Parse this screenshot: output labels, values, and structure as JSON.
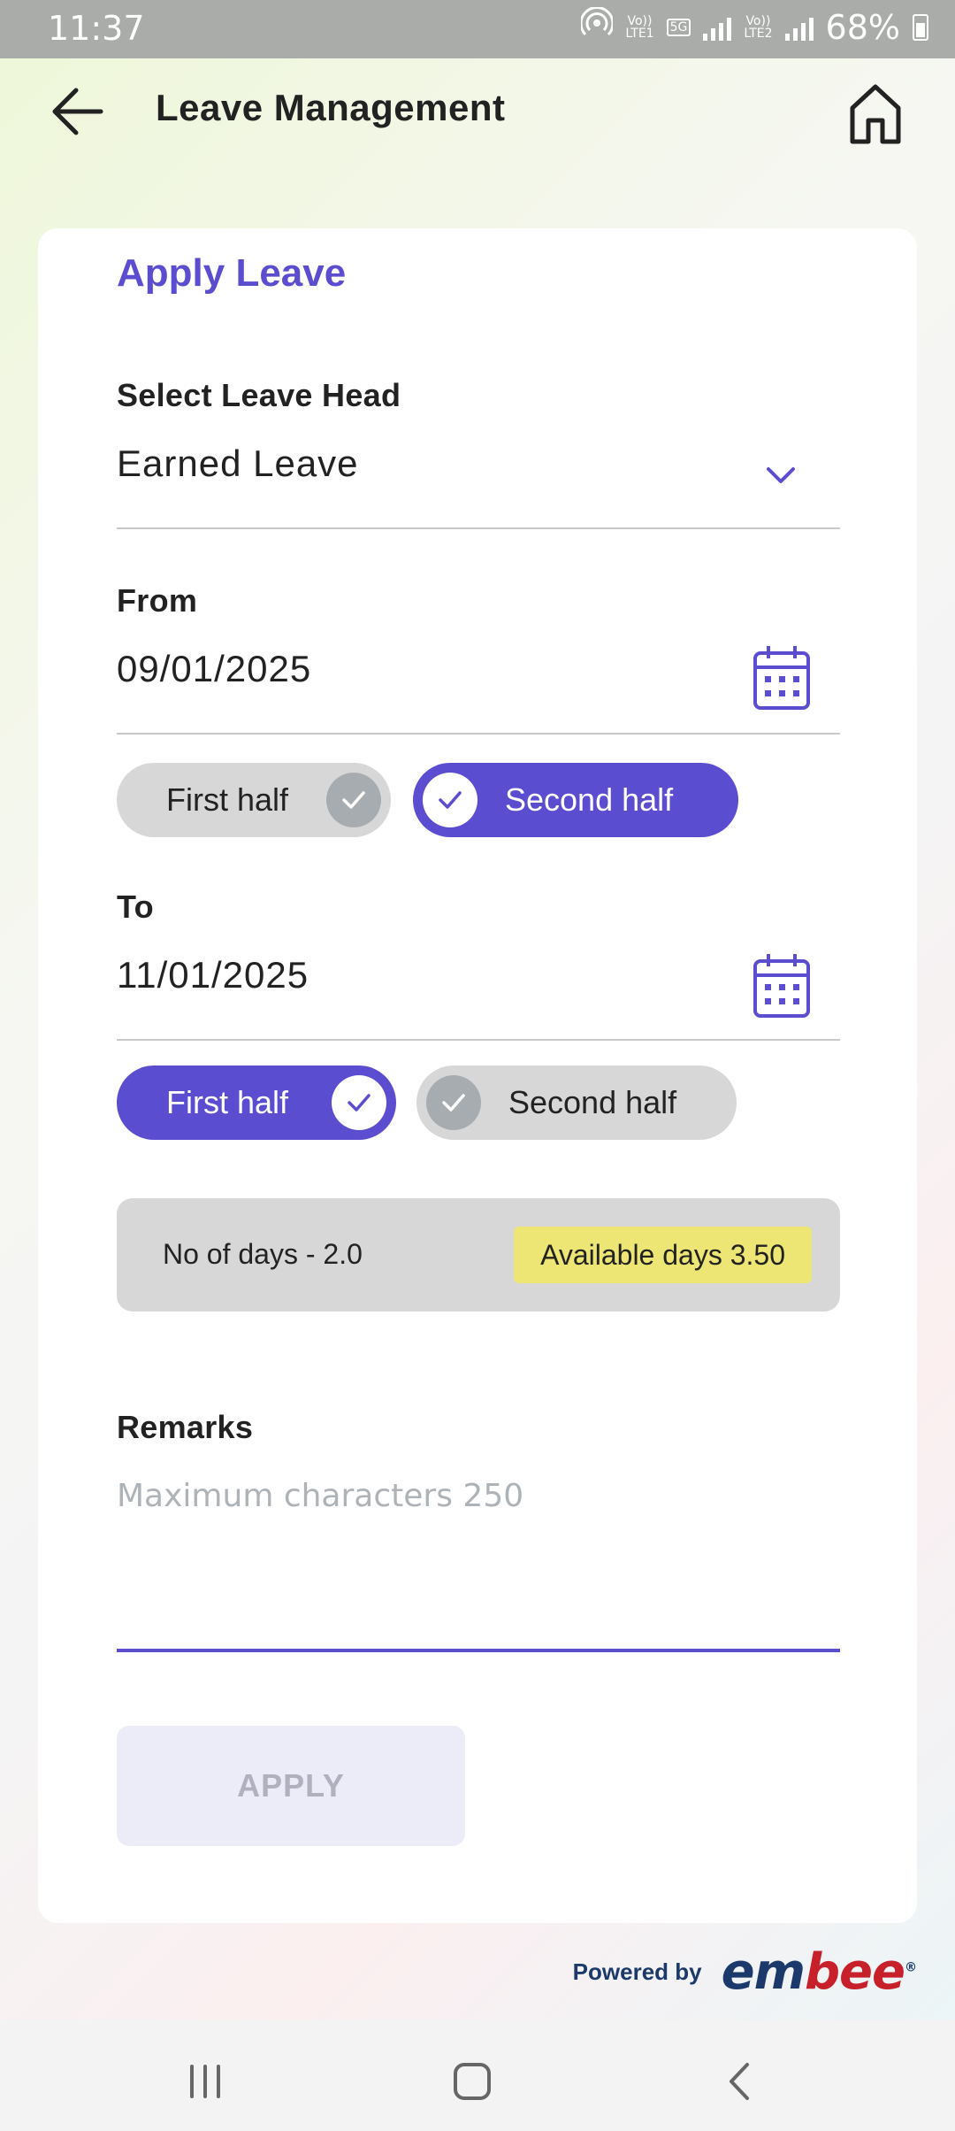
{
  "status_bar": {
    "time": "11:37",
    "sim1_top": "Vo))",
    "sim1_bottom": "LTE1",
    "network": "5G",
    "sim2_top": "Vo))",
    "sim2_bottom": "LTE2",
    "battery": "68%"
  },
  "app_bar": {
    "title": "Leave Management",
    "back_icon": "arrow-left-icon",
    "home_icon": "home-icon"
  },
  "form": {
    "title": "Apply Leave",
    "leave_head": {
      "label": "Select Leave Head",
      "value": "Earned Leave"
    },
    "from": {
      "label": "From",
      "date": "09/01/2025",
      "first_half": {
        "label": "First half",
        "selected": false
      },
      "second_half": {
        "label": "Second half",
        "selected": true
      }
    },
    "to": {
      "label": "To",
      "date": "11/01/2025",
      "first_half": {
        "label": "First half",
        "selected": true
      },
      "second_half": {
        "label": "Second half",
        "selected": false
      }
    },
    "days": {
      "no_of_days": "No of days - 2.0",
      "available": "Available days 3.50"
    },
    "remarks": {
      "label": "Remarks",
      "placeholder": "Maximum characters 250"
    },
    "apply_label": "APPLY"
  },
  "footer": {
    "powered_by": "Powered by",
    "brand_em": "em",
    "brand_bee": "bee",
    "registered": "®"
  },
  "colors": {
    "accent": "#5b4dd0",
    "status_bar": "#a9aca8",
    "available_badge": "#ede674"
  }
}
